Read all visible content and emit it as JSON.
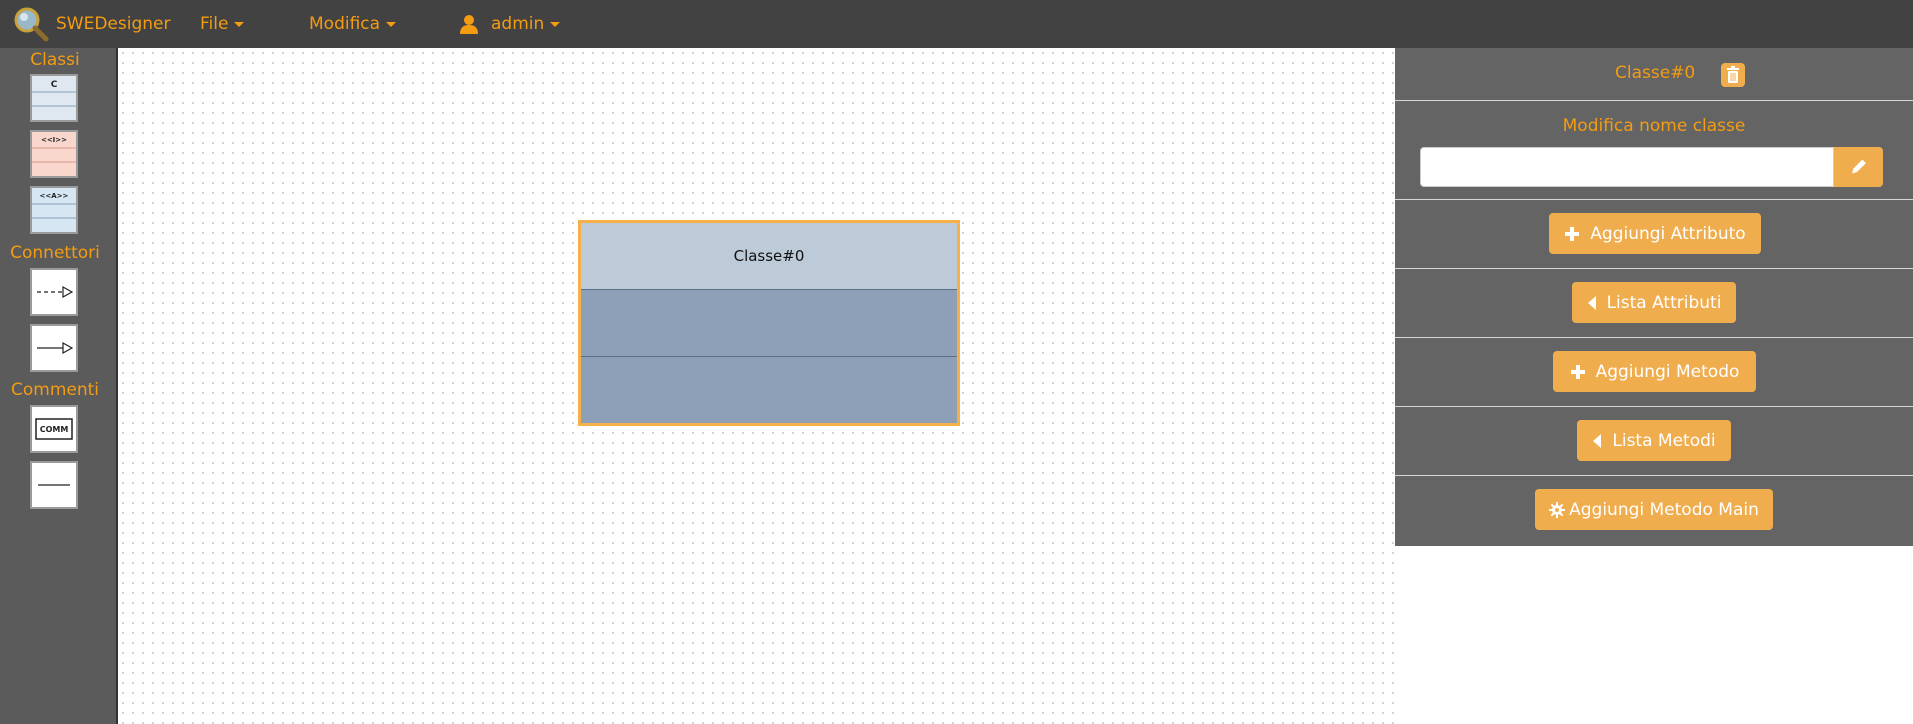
{
  "navbar": {
    "brand": "SWEDesigner",
    "menus": [
      {
        "label": "File"
      },
      {
        "label": "Modifica"
      }
    ],
    "user": "admin"
  },
  "palette": {
    "sections": {
      "classi": "Classi",
      "connettori": "Connettori",
      "commenti": "Commenti"
    },
    "tool_labels": {
      "class": "C",
      "interface": "<<I>>",
      "abstract": "<<A>>",
      "comment": "COMM"
    }
  },
  "canvas": {
    "class_name": "Classe#0"
  },
  "panel": {
    "title": "Classe#0",
    "rename_label": "Modifica nome classe",
    "rename_value": "",
    "buttons": {
      "add_attribute": "Aggiungi Attributo",
      "list_attributes": "Lista Attributi",
      "add_method": "Aggiungi Metodo",
      "list_methods": "Lista Metodi",
      "add_main": "Aggiungi Metodo Main"
    }
  },
  "colors": {
    "accent": "#f39c12",
    "button": "#f0ad4e",
    "navbar": "#424242",
    "panel": "#646464"
  }
}
